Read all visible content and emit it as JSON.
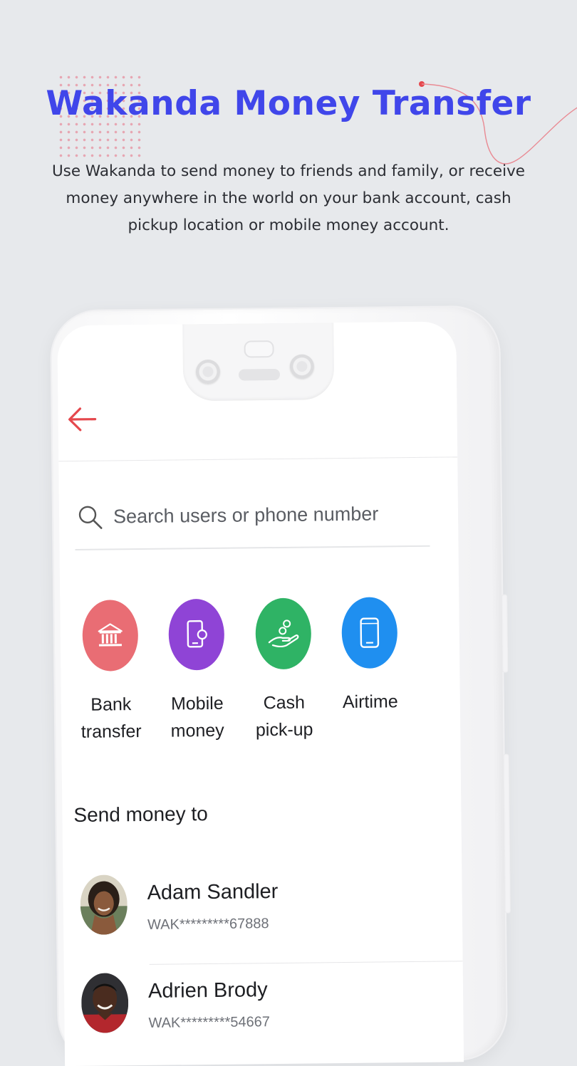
{
  "promo": {
    "title": "Wakanda Money Transfer",
    "subtitle": "Use Wakanda to send money to friends and family, or receive money anywhere in the world on your bank account, cash pickup location or mobile money account."
  },
  "colors": {
    "headline": "#4046ea",
    "back_arrow": "#e5484d",
    "bank_transfer": "#e96d74",
    "mobile_money": "#8f44d6",
    "cash_pickup": "#2fb365",
    "airtime": "#1f8ff0"
  },
  "app": {
    "search": {
      "placeholder": "Search users or phone number",
      "icon": "search-icon"
    },
    "actions": [
      {
        "label": "Bank\ntransfer",
        "icon": "bank-icon"
      },
      {
        "label": "Mobile\nmoney",
        "icon": "mobile-money-icon"
      },
      {
        "label": "Cash\npick-up",
        "icon": "cash-hand-icon"
      },
      {
        "label": "Airtime",
        "icon": "phone-icon"
      }
    ],
    "section_title": "Send money to",
    "contacts": [
      {
        "name": "Adam Sandler",
        "account": "WAK*********67888"
      },
      {
        "name": "Adrien Brody",
        "account": "WAK*********54667"
      }
    ]
  }
}
